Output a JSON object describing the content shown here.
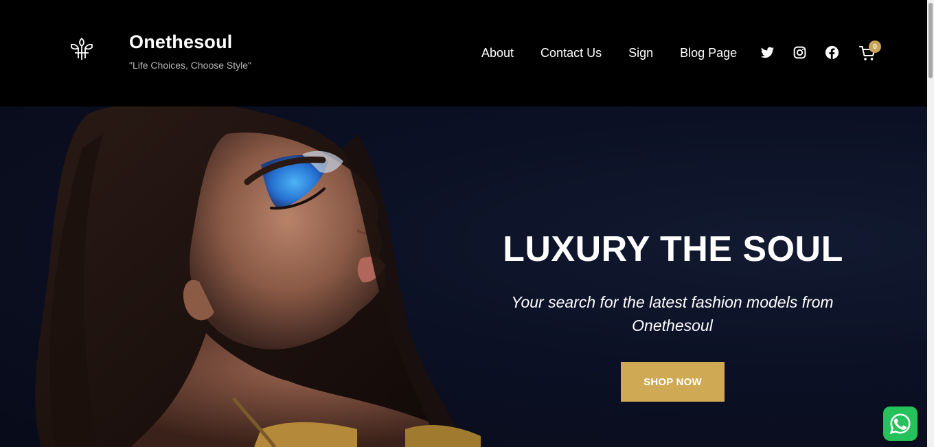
{
  "brand": {
    "name": "Onethesoul",
    "tagline": "\"Life Choices, Choose Style\""
  },
  "nav": {
    "items": [
      {
        "label": "About"
      },
      {
        "label": "Contact Us"
      },
      {
        "label": "Sign"
      },
      {
        "label": "Blog Page"
      }
    ]
  },
  "social": {
    "icons": [
      "twitter-icon",
      "instagram-icon",
      "facebook-icon"
    ]
  },
  "cart": {
    "count": "0",
    "icon": "cart-icon"
  },
  "hero": {
    "title": "LUXURY THE SOUL",
    "subtitle": "Your search for the latest fashion models from Onethesoul",
    "button_label": "SHOP NOW"
  },
  "floating": {
    "icon": "whatsapp-icon"
  },
  "colors": {
    "header_bg": "#000000",
    "accent": "#d0a955",
    "hero_bg": "#0b1024",
    "whatsapp": "#25c15a"
  }
}
